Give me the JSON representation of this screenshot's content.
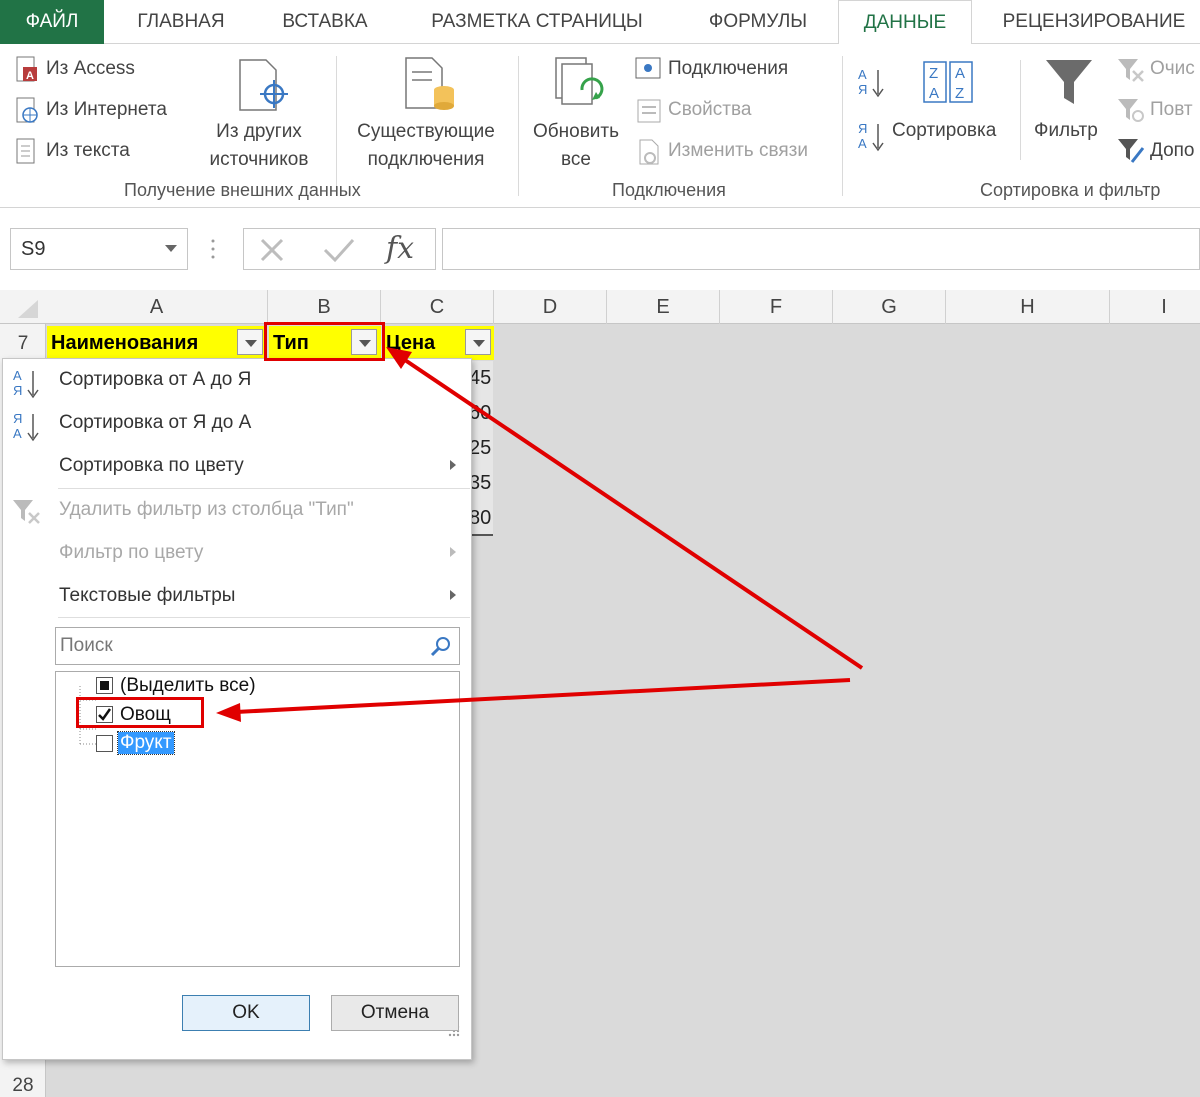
{
  "tabs": [
    "ФАЙЛ",
    "ГЛАВНАЯ",
    "ВСТАВКА",
    "РАЗМЕТКА СТРАНИЦЫ",
    "ФОРМУЛЫ",
    "ДАННЫЕ",
    "РЕЦЕНЗИРОВАНИЕ"
  ],
  "ribbon": {
    "external": {
      "from_access": "Из Access",
      "from_web": "Из Интернета",
      "from_text": "Из текста",
      "other_sources_1": "Из других",
      "other_sources_2": "источников",
      "existing_1": "Существующие",
      "existing_2": "подключения",
      "group_label": "Получение внешних данных"
    },
    "connections": {
      "refresh_1": "Обновить",
      "refresh_2": "все",
      "connections": "Подключения",
      "properties": "Свойства",
      "edit_links": "Изменить связи",
      "group_label": "Подключения"
    },
    "sort_filter": {
      "sort": "Сортировка",
      "filter": "Фильтр",
      "clear": "Очис",
      "reapply": "Повт",
      "advanced": "Допо",
      "group_label": "Сортировка и фильтр"
    }
  },
  "formula_bar": {
    "name_box": "S9",
    "fx": "fx"
  },
  "columns": [
    "A",
    "B",
    "C",
    "D",
    "E",
    "F",
    "G",
    "H",
    "I"
  ],
  "rows": {
    "first": "7",
    "last": "28"
  },
  "header_cells": {
    "a": "Наименования",
    "b": "Тип",
    "c": "Цена"
  },
  "partial_values": [
    "45",
    "60",
    "25",
    "35",
    "80"
  ],
  "menu": {
    "sort_az": "Сортировка от А до Я",
    "sort_za": "Сортировка от Я до А",
    "sort_color": "Сортировка по цвету",
    "remove_filter": "Удалить фильтр из столбца \"Тип\"",
    "filter_color": "Фильтр по цвету",
    "text_filters": "Текстовые фильтры",
    "search_placeholder": "Поиск",
    "select_all": "(Выделить все)",
    "items": [
      {
        "label": "Овощ",
        "checked": true
      },
      {
        "label": "Фрукт",
        "checked": false
      }
    ],
    "ok": "OK",
    "cancel": "Отмена"
  },
  "colors": {
    "accent": "#217346",
    "highlight": "#ffff00",
    "annotation": "#e00000",
    "selection": "#3399ff"
  }
}
